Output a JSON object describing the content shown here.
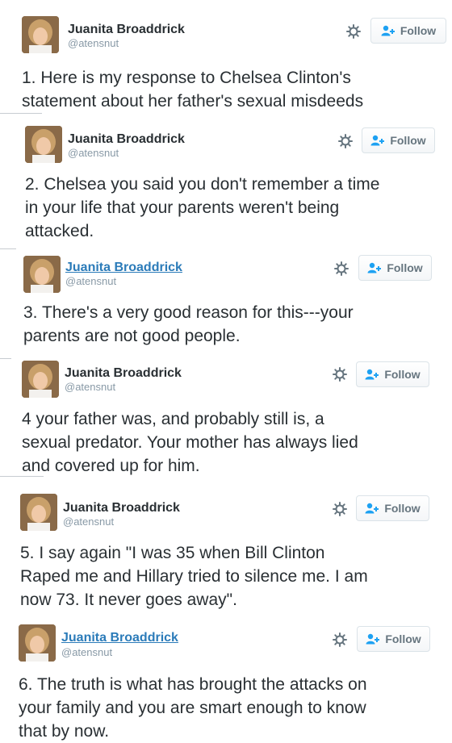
{
  "author": {
    "name": "Juanita Broaddrick",
    "handle": "@atensnut"
  },
  "follow_label": "Follow",
  "icons": {
    "settings": "gear-icon",
    "follow": "add-person-icon"
  },
  "colors": {
    "link": "#2b7bb9",
    "handle": "#8899a6",
    "button_text": "#66757f",
    "follow_icon": "#1da1f2"
  },
  "tweets": [
    {
      "text": "1. Here is my response to Chelsea Clinton's\nstatement about her father's sexual misdeeds"
    },
    {
      "text": "2. Chelsea you said you don't remember a time\nin your life that your parents weren't being\nattacked."
    },
    {
      "text": "3. There's a very good reason for this---your\nparents are not good people."
    },
    {
      "text": "4  your father was, and probably still is, a\nsexual predator. Your mother has always lied\nand covered up for him."
    },
    {
      "text": "5. I say again \"I was 35 when Bill Clinton\nRaped me and Hillary tried to silence me. I am\nnow 73. It never goes away\"."
    },
    {
      "text": "6. The truth is what has brought the attacks on\nyour family and you are smart enough to know\nthat by now."
    }
  ]
}
